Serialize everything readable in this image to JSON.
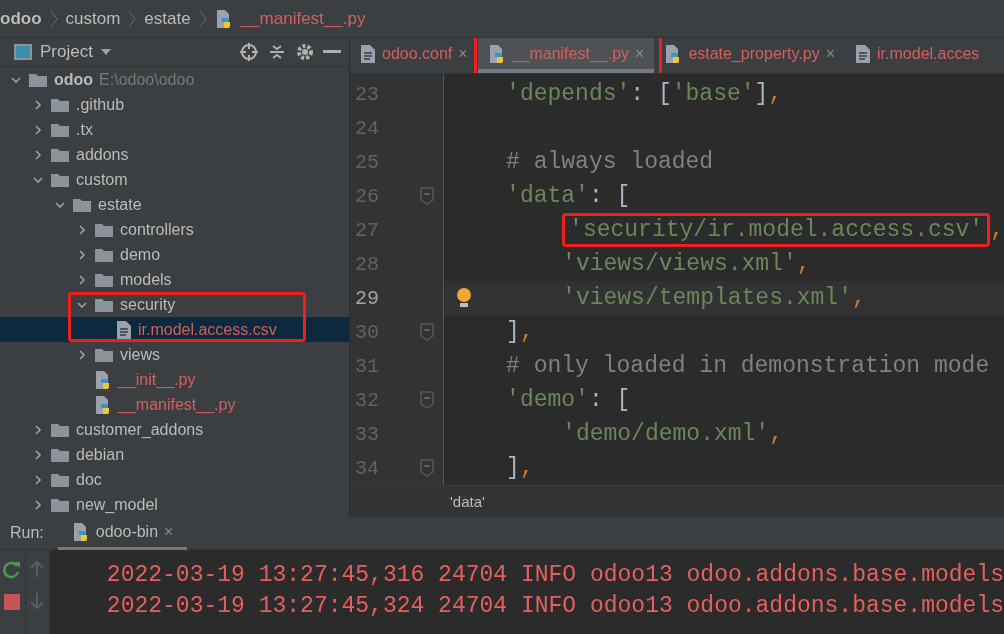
{
  "breadcrumb": [
    {
      "label": "odoo",
      "kind": "root"
    },
    {
      "label": "custom",
      "kind": "folder"
    },
    {
      "label": "estate",
      "kind": "folder"
    },
    {
      "label": "__manifest__.py",
      "kind": "python"
    }
  ],
  "project_panel": {
    "title": "Project",
    "tree": [
      {
        "label": "odoo",
        "path": "E:\\odoo\\odoo",
        "kind": "root",
        "expanded": true,
        "children": [
          {
            "label": ".github",
            "kind": "folder",
            "expanded": false
          },
          {
            "label": ".tx",
            "kind": "folder",
            "expanded": false
          },
          {
            "label": "addons",
            "kind": "folder",
            "expanded": false
          },
          {
            "label": "custom",
            "kind": "folder",
            "expanded": true,
            "children": [
              {
                "label": "estate",
                "kind": "folder",
                "expanded": true,
                "children": [
                  {
                    "label": "controllers",
                    "kind": "folder",
                    "expanded": false
                  },
                  {
                    "label": "demo",
                    "kind": "folder",
                    "expanded": false
                  },
                  {
                    "label": "models",
                    "kind": "folder",
                    "expanded": false
                  },
                  {
                    "label": "security",
                    "kind": "folder",
                    "expanded": true,
                    "annotated": true,
                    "children": [
                      {
                        "label": "ir.model.access.csv",
                        "kind": "text",
                        "selected": true
                      }
                    ]
                  },
                  {
                    "label": "views",
                    "kind": "folder",
                    "expanded": false
                  },
                  {
                    "label": "__init__.py",
                    "kind": "python",
                    "selected": false
                  },
                  {
                    "label": "__manifest__.py",
                    "kind": "python",
                    "selected": false
                  }
                ]
              }
            ]
          },
          {
            "label": "customer_addons",
            "kind": "folder",
            "expanded": false
          },
          {
            "label": "debian",
            "kind": "folder",
            "expanded": false
          },
          {
            "label": "doc",
            "kind": "folder",
            "expanded": false
          },
          {
            "label": "new_model",
            "kind": "folder",
            "expanded": false
          }
        ]
      }
    ]
  },
  "tabs": [
    {
      "label": "odoo.conf",
      "kind": "text",
      "close": "×",
      "selected": false,
      "annotated": false
    },
    {
      "label": "__manifest__.py",
      "kind": "python",
      "close": "×",
      "selected": true,
      "annotated": true
    },
    {
      "label": "estate_property.py",
      "kind": "python",
      "close": "×",
      "selected": false,
      "annotated": false
    },
    {
      "label": "ir.model.acces",
      "kind": "text",
      "selected": false,
      "annotated": false
    }
  ],
  "code": [
    {
      "number": "23",
      "current": false,
      "fold": false,
      "tokens": [
        {
          "kind": "string",
          "text": "'depends'"
        },
        {
          "kind": "punct",
          "text": ": ["
        },
        {
          "kind": "string",
          "text": "'base'"
        },
        {
          "kind": "punct",
          "text": "]"
        },
        {
          "kind": "comma",
          "text": ","
        }
      ]
    },
    {
      "number": "24",
      "current": false,
      "fold": false
    },
    {
      "number": "25",
      "current": false,
      "fold": false,
      "tokens": [
        {
          "kind": "comment",
          "text": "# always loaded"
        }
      ]
    },
    {
      "number": "26",
      "current": false,
      "fold": true,
      "tokens": [
        {
          "kind": "string",
          "text": "'data'"
        },
        {
          "kind": "punct",
          "text": ": ["
        }
      ],
      "children": [
        {
          "number": "27",
          "current": false,
          "fold": false,
          "tokens": [
            {
              "kind": "string",
              "text": "'security/ir.model.access.csv'",
              "annotated": true
            },
            {
              "kind": "comma",
              "text": ","
            }
          ]
        },
        {
          "number": "28",
          "current": false,
          "fold": false,
          "tokens": [
            {
              "kind": "string",
              "text": "'views/views.xml'"
            },
            {
              "kind": "comma",
              "text": ","
            }
          ]
        },
        {
          "number": "29",
          "current": true,
          "fold": false,
          "tokens": [
            {
              "kind": "string",
              "text": "'views/templates.xml'"
            },
            {
              "kind": "comma",
              "text": ","
            }
          ]
        }
      ]
    },
    {
      "number": "30",
      "current": false,
      "fold": true,
      "tokens": [
        {
          "kind": "punct",
          "text": "]"
        },
        {
          "kind": "comma",
          "text": ","
        }
      ]
    },
    {
      "number": "31",
      "current": false,
      "fold": false,
      "tokens": [
        {
          "kind": "comment",
          "text": "# only loaded in demonstration mode"
        }
      ]
    },
    {
      "number": "32",
      "current": false,
      "fold": true,
      "tokens": [
        {
          "kind": "string",
          "text": "'demo'"
        },
        {
          "kind": "punct",
          "text": ": ["
        }
      ],
      "children": [
        {
          "number": "33",
          "current": false,
          "fold": false,
          "tokens": [
            {
              "kind": "string",
              "text": "'demo/demo.xml'"
            },
            {
              "kind": "comma",
              "text": ","
            }
          ]
        }
      ]
    },
    {
      "number": "34",
      "current": false,
      "fold": true,
      "tokens": [
        {
          "kind": "punct",
          "text": "]"
        },
        {
          "kind": "comma",
          "text": ","
        }
      ]
    }
  ],
  "editor_breadcrumb": "'data'",
  "run": {
    "label": "Run:",
    "tab": "odoo-bin",
    "close": "×",
    "lines": [
      "2022-03-19 13:27:45,316 24704 INFO odoo13 odoo.addons.base.models",
      "2022-03-19 13:27:45,324 24704 INFO odoo13 odoo.addons.base.models"
    ]
  }
}
